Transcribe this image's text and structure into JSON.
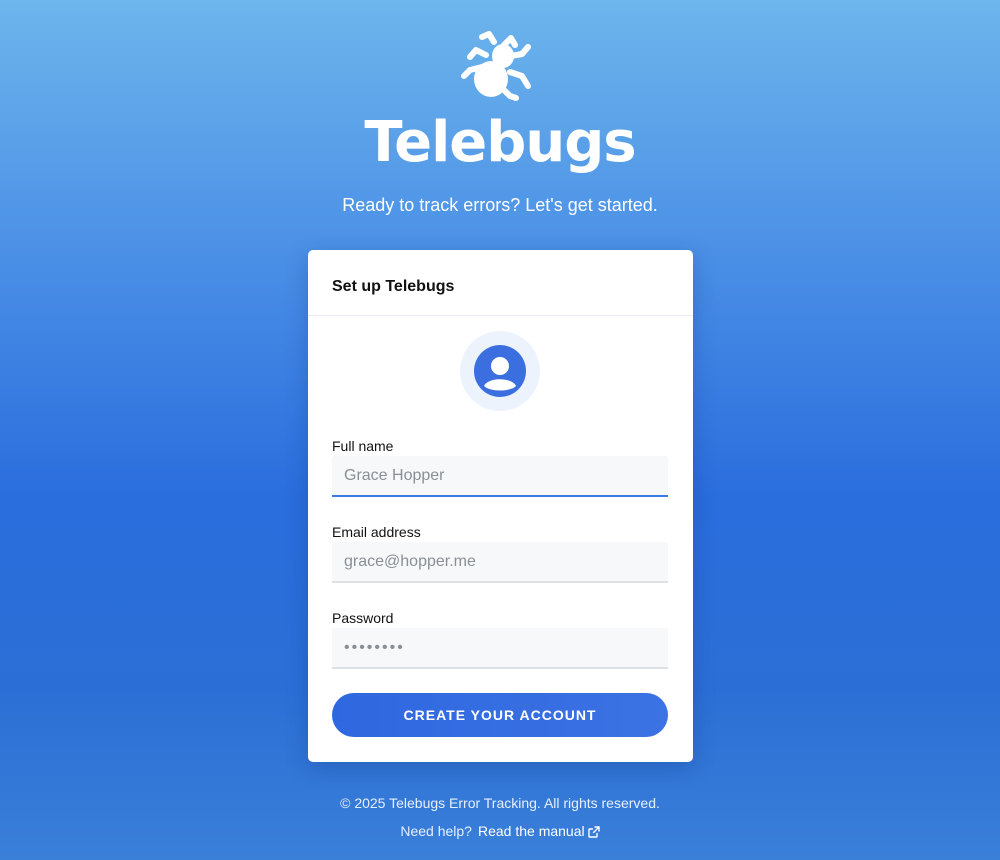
{
  "brand": {
    "name": "Telebugs",
    "tagline": "Ready to track errors? Let's get started.",
    "logo_icon": "bug-icon"
  },
  "card": {
    "title": "Set up Telebugs",
    "avatar_icon": "user-avatar-icon",
    "fields": [
      {
        "label": "Full name",
        "placeholder": "Grace Hopper",
        "type": "text"
      },
      {
        "label": "Email address",
        "placeholder": "grace@hopper.me",
        "type": "email"
      },
      {
        "label": "Password",
        "placeholder": "••••••••",
        "type": "password"
      }
    ],
    "submit_label": "CREATE YOUR ACCOUNT"
  },
  "footer": {
    "copyright": "© 2025 Telebugs Error Tracking. All rights reserved.",
    "help_prefix": "Need help?",
    "help_link": "Read the manual",
    "help_link_icon": "external-link-icon"
  },
  "colors": {
    "accent": "#2f67e0",
    "background_top": "#6db5ec",
    "background_mid": "#2a6ddd"
  }
}
